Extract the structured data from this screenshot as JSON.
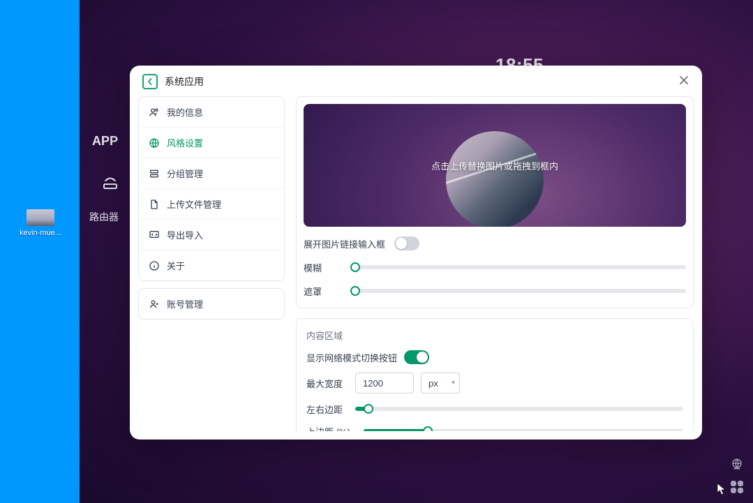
{
  "desktop": {
    "icon_label": "kevin-mue...",
    "app_label": "APP",
    "router_label": "路由器",
    "clock": "18:55"
  },
  "modal": {
    "title": "系统应用",
    "sidebar": {
      "group1": {
        "my_info": "我的信息",
        "style_settings": "风格设置",
        "group_manage": "分组管理",
        "upload_manage": "上传文件管理",
        "import_export": "导出导入",
        "about": "关于"
      },
      "group2": {
        "account_manage": "账号管理"
      }
    },
    "upload": {
      "hint": "点击上传替换图片或拖拽到框内",
      "expand_link_input": "展开图片链接输入框",
      "blur_label": "模糊",
      "mask_label": "遮罩"
    },
    "content_area": {
      "title": "内容区域",
      "show_switch_btn": "显示网络模式切换按钮",
      "max_width_label": "最大宽度",
      "max_width_value": "1200",
      "max_width_unit": "px",
      "hmargin_label": "左右边距",
      "tmargin_label": "上边距 (%)"
    }
  }
}
